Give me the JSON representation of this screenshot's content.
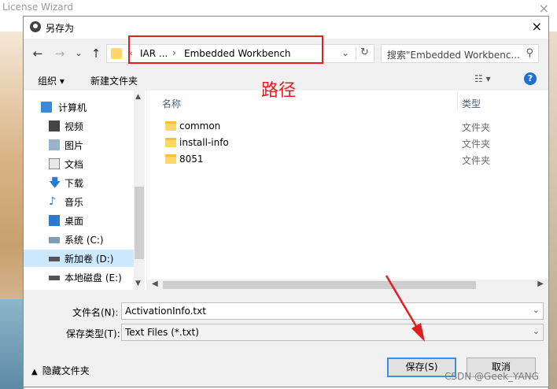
{
  "background_window": {
    "title": "License Wizard",
    "close": "×"
  },
  "dialog": {
    "title": "另存为",
    "close": "×",
    "nav": {
      "back": "←",
      "forward": "→",
      "recent": "⌄",
      "up": "↑"
    },
    "address": {
      "prefix": "«",
      "crumbs": [
        "IAR ...",
        "Embedded Workbench"
      ],
      "separator": "›",
      "dropdown": "⌄",
      "refresh": "↻"
    },
    "search": {
      "placeholder": "搜索\"Embedded Workbenc...",
      "icon": "search-icon"
    },
    "toolbar": {
      "organize": "组织 ▾",
      "new_folder": "新建文件夹",
      "view": "☷ ▾",
      "help": "?"
    },
    "annotation": "路径",
    "nav_items": [
      {
        "label": "计算机",
        "icon": "computer-icon"
      },
      {
        "label": "视频",
        "icon": "video-icon"
      },
      {
        "label": "图片",
        "icon": "pictures-icon"
      },
      {
        "label": "文档",
        "icon": "documents-icon"
      },
      {
        "label": "下载",
        "icon": "download-icon"
      },
      {
        "label": "音乐",
        "icon": "music-icon"
      },
      {
        "label": "桌面",
        "icon": "desktop-icon"
      },
      {
        "label": "系统 (C:)",
        "icon": "drive-icon"
      },
      {
        "label": "新加卷 (D:)",
        "icon": "drive-icon",
        "selected": true
      },
      {
        "label": "本地磁盘 (E:)",
        "icon": "drive-icon"
      }
    ],
    "columns": {
      "name": "名称",
      "type": "类型"
    },
    "files": [
      {
        "name": "common",
        "type": "文件夹"
      },
      {
        "name": "install-info",
        "type": "文件夹"
      },
      {
        "name": "8051",
        "type": "文件夹"
      }
    ],
    "filename": {
      "label": "文件名(N):",
      "value": "ActivationInfo.txt"
    },
    "filetype": {
      "label": "保存类型(T):",
      "value": "Text Files (*.txt)"
    },
    "hide_folders": "隐藏文件夹",
    "save": "保存(S)",
    "cancel": "取消"
  },
  "watermark": "CSDN @Geek_YANG",
  "colors": {
    "annotation": "#e02020",
    "selection": "#cce8ff",
    "accent": "#3c8ee8"
  }
}
